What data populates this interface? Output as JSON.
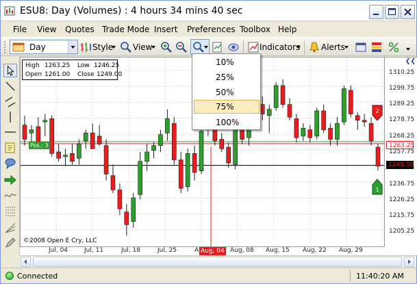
{
  "window": {
    "title": "ESU8: Day (Volumes) : 4 hours 34 mins 40 sec"
  },
  "menu": [
    "File",
    "View",
    "Quotes",
    "Trade Mode",
    "Insert",
    "Preferences",
    "Toolbox",
    "Help"
  ],
  "toolbar": {
    "period_value": "Day",
    "style_label": "Style",
    "view_label": "View",
    "indicators_label": "Indicators",
    "alerts_label": "Alerts"
  },
  "zoom_menu": {
    "options": [
      "10%",
      "25%",
      "50%",
      "75%",
      "100%"
    ],
    "selected": "75%"
  },
  "ohlc": {
    "high_label": "High",
    "high": "1263.25",
    "low_label": "Low",
    "low": "1246.25",
    "open_label": "Open",
    "open": "1261.00",
    "close_label": "Close",
    "close": "1249.00"
  },
  "position_tag": "Pos.: 3",
  "copyright": "©2008 Open E Cry, LLC",
  "price_axis": {
    "ticks": [
      "1310.25",
      "1299.75",
      "1289.25",
      "1278.75",
      "1268.25",
      "1257.75",
      "1247.25",
      "1236.75",
      "1226.25",
      "1215.75",
      "1205.25"
    ],
    "last_price_badge": "1263.25",
    "current_price_badge": "1249.50",
    "order_marker_sell": "2",
    "order_marker_buy": "1"
  },
  "time_axis": {
    "ticks": [
      "Jul, 04",
      "Jul, 11",
      "Jul, 18",
      "Jul, 25",
      "Au",
      "Aug, 08",
      "Aug, 15",
      "Aug, 22",
      "Aug, 29"
    ],
    "cursor_label": "Aug, 04"
  },
  "status": {
    "connection": "Connected",
    "time": "11:40:20 AM"
  },
  "colors": {
    "bull": "#2e9e2e",
    "bear": "#e81d1d",
    "menu_highlight": "#fbecc2",
    "window_frame": "#ece9d8"
  },
  "chart_data": {
    "type": "candlestick",
    "instrument": "ESU8",
    "period": "Day",
    "ylim": [
      1200,
      1316
    ],
    "candles": [
      {
        "o": 1275,
        "h": 1281,
        "l": 1262,
        "c": 1266
      },
      {
        "o": 1270,
        "h": 1275,
        "l": 1264,
        "c": 1272
      },
      {
        "o": 1274,
        "h": 1280,
        "l": 1262,
        "c": 1263
      },
      {
        "o": 1277,
        "h": 1282,
        "l": 1268,
        "c": 1278
      },
      {
        "o": 1279,
        "h": 1281,
        "l": 1255,
        "c": 1257
      },
      {
        "o": 1258,
        "h": 1263,
        "l": 1252,
        "c": 1254
      },
      {
        "o": 1255,
        "h": 1260,
        "l": 1249,
        "c": 1256
      },
      {
        "o": 1257,
        "h": 1263,
        "l": 1250,
        "c": 1252
      },
      {
        "o": 1254,
        "h": 1266,
        "l": 1250,
        "c": 1263
      },
      {
        "o": 1265,
        "h": 1272,
        "l": 1260,
        "c": 1270
      },
      {
        "o": 1270,
        "h": 1276,
        "l": 1265,
        "c": 1260
      },
      {
        "o": 1268,
        "h": 1275,
        "l": 1262,
        "c": 1263
      },
      {
        "o": 1262,
        "h": 1266,
        "l": 1240,
        "c": 1244
      },
      {
        "o": 1243,
        "h": 1250,
        "l": 1232,
        "c": 1234
      },
      {
        "o": 1234,
        "h": 1238,
        "l": 1218,
        "c": 1222
      },
      {
        "o": 1220,
        "h": 1225,
        "l": 1205,
        "c": 1212
      },
      {
        "o": 1214,
        "h": 1232,
        "l": 1210,
        "c": 1229
      },
      {
        "o": 1231,
        "h": 1258,
        "l": 1228,
        "c": 1252
      },
      {
        "o": 1252,
        "h": 1263,
        "l": 1246,
        "c": 1258
      },
      {
        "o": 1259,
        "h": 1264,
        "l": 1254,
        "c": 1262
      },
      {
        "o": 1262,
        "h": 1272,
        "l": 1258,
        "c": 1269
      },
      {
        "o": 1270,
        "h": 1285,
        "l": 1265,
        "c": 1279
      },
      {
        "o": 1276,
        "h": 1280,
        "l": 1250,
        "c": 1253
      },
      {
        "o": 1253,
        "h": 1258,
        "l": 1232,
        "c": 1235
      },
      {
        "o": 1236,
        "h": 1260,
        "l": 1233,
        "c": 1257
      },
      {
        "o": 1257,
        "h": 1262,
        "l": 1240,
        "c": 1245
      },
      {
        "o": 1246,
        "h": 1275,
        "l": 1244,
        "c": 1271
      },
      {
        "o": 1272,
        "h": 1290,
        "l": 1268,
        "c": 1286
      },
      {
        "o": 1284,
        "h": 1290,
        "l": 1262,
        "c": 1265
      },
      {
        "o": 1266,
        "h": 1270,
        "l": 1258,
        "c": 1260
      },
      {
        "o": 1261,
        "h": 1264,
        "l": 1248,
        "c": 1251
      },
      {
        "o": 1250,
        "h": 1280,
        "l": 1247,
        "c": 1277
      },
      {
        "o": 1278,
        "h": 1283,
        "l": 1263,
        "c": 1266
      },
      {
        "o": 1267,
        "h": 1280,
        "l": 1262,
        "c": 1276
      },
      {
        "o": 1276,
        "h": 1290,
        "l": 1272,
        "c": 1288
      },
      {
        "o": 1288,
        "h": 1293,
        "l": 1278,
        "c": 1282
      },
      {
        "o": 1281,
        "h": 1288,
        "l": 1270,
        "c": 1285
      },
      {
        "o": 1286,
        "h": 1302,
        "l": 1284,
        "c": 1300
      },
      {
        "o": 1300,
        "h": 1304,
        "l": 1286,
        "c": 1288
      },
      {
        "o": 1288,
        "h": 1292,
        "l": 1278,
        "c": 1280
      },
      {
        "o": 1279,
        "h": 1282,
        "l": 1264,
        "c": 1267
      },
      {
        "o": 1268,
        "h": 1276,
        "l": 1265,
        "c": 1273
      },
      {
        "o": 1272,
        "h": 1275,
        "l": 1264,
        "c": 1267
      },
      {
        "o": 1268,
        "h": 1286,
        "l": 1266,
        "c": 1284
      },
      {
        "o": 1284,
        "h": 1288,
        "l": 1270,
        "c": 1272
      },
      {
        "o": 1273,
        "h": 1276,
        "l": 1262,
        "c": 1266
      },
      {
        "o": 1266,
        "h": 1280,
        "l": 1262,
        "c": 1276
      },
      {
        "o": 1277,
        "h": 1300,
        "l": 1275,
        "c": 1298
      },
      {
        "o": 1297,
        "h": 1300,
        "l": 1280,
        "c": 1282
      },
      {
        "o": 1281,
        "h": 1283,
        "l": 1272,
        "c": 1278
      },
      {
        "o": 1278,
        "h": 1282,
        "l": 1274,
        "c": 1277
      },
      {
        "o": 1276,
        "h": 1280,
        "l": 1262,
        "c": 1265
      },
      {
        "o": 1261,
        "h": 1263.25,
        "l": 1246.25,
        "c": 1249
      }
    ],
    "horizontal_lines": [
      {
        "price": 1263.25,
        "color": "#e81d1d"
      },
      {
        "price": 1264.5,
        "color": "#2e9e2e"
      },
      {
        "price": 1249.5,
        "color": "#000000"
      }
    ]
  }
}
